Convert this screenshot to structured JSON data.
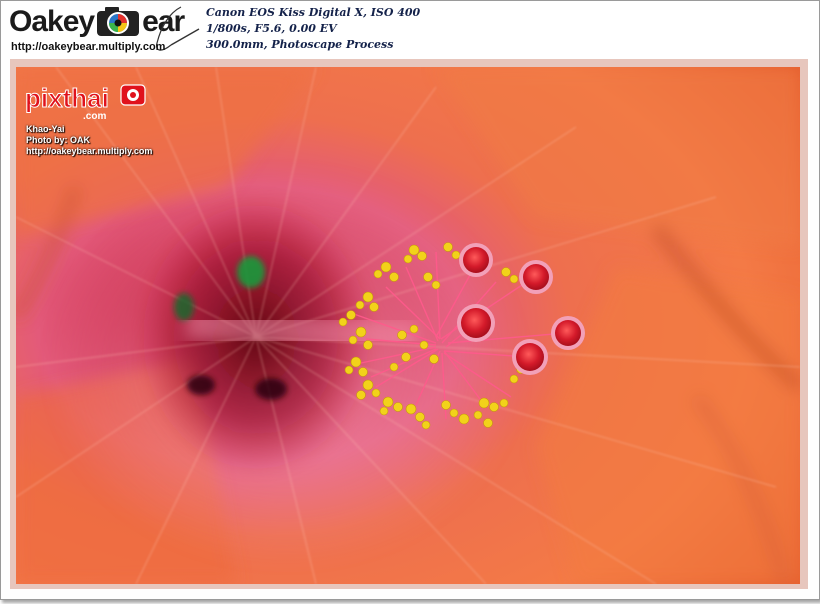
{
  "header": {
    "logo_left": "Oakey",
    "logo_right": "ear",
    "logo_icon": "camera-lens-icon",
    "site_url": "http://oakeybear.multiply.com",
    "exif_lines": [
      "Canon EOS Kiss Digital X, ISO 400",
      "1/800s, F5.6, 0.00 EV",
      "300.0mm, Photoscape Process"
    ]
  },
  "photo": {
    "subject": "hibiscus-flower-macro",
    "colors": {
      "petal": "#f06a40",
      "center": "#c81828",
      "stigma": "#d41a2a",
      "pollen": "#f2d21a"
    }
  },
  "watermark": {
    "brand": "pixthai",
    "brand_sub": ".com",
    "lines": [
      "Khao-Yai",
      "Photo by: OAK",
      "http://oakeybear.multiply.com"
    ]
  }
}
